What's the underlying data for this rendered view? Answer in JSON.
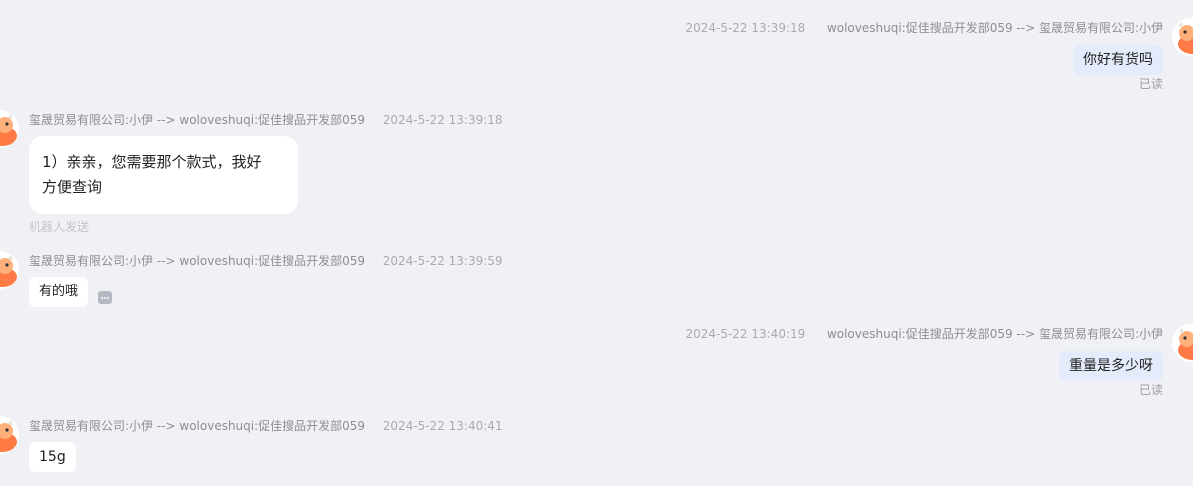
{
  "messages": [
    {
      "direction": "out",
      "timestamp": "2024-5-22 13:39:18",
      "route": "woloveshuqi:促佳搜品开发部059 --> 玺晟贸易有限公司:小伊",
      "text": "你好有货吗",
      "status": "已读"
    },
    {
      "direction": "in",
      "route": "玺晟贸易有限公司:小伊 --> woloveshuqi:促佳搜品开发部059",
      "timestamp": "2024-5-22 13:39:18",
      "text_line1": "1）亲亲，您需要那个款式，我好",
      "text_line2": "方便查询",
      "note": "机器人发送"
    },
    {
      "direction": "in",
      "route": "玺晟贸易有限公司:小伊 --> woloveshuqi:促佳搜品开发部059",
      "timestamp": "2024-5-22 13:39:59",
      "text": "有的哦"
    },
    {
      "direction": "out",
      "timestamp": "2024-5-22 13:40:19",
      "route": "woloveshuqi:促佳搜品开发部059 --> 玺晟贸易有限公司:小伊",
      "text": "重量是多少呀",
      "status": "已读"
    },
    {
      "direction": "in",
      "route": "玺晟贸易有限公司:小伊 --> woloveshuqi:促佳搜品开发部059",
      "timestamp": "2024-5-22 13:40:41",
      "text": "15g"
    }
  ],
  "colors": {
    "background": "#f0f1f5",
    "outgoing_bubble": "#e4ebfb",
    "incoming_bubble": "#ffffff",
    "avatar_accent": "#ff7a45"
  },
  "icons": {
    "avatar": "orange-cartoon-mascot-avatar",
    "more": "more-options-icon"
  }
}
